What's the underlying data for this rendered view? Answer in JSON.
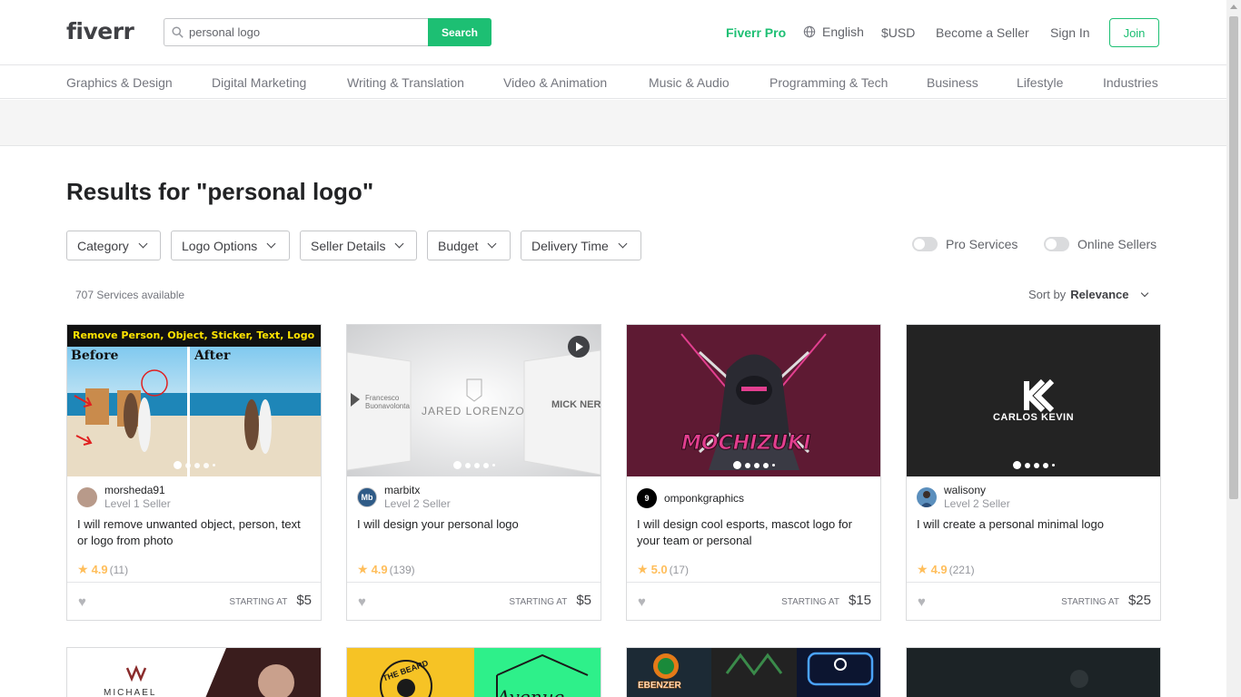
{
  "header": {
    "logo": "fiverr",
    "search_placeholder": "personal logo",
    "search_button": "Search",
    "fiverr_pro": "Fiverr Pro",
    "language": "English",
    "currency": "$USD",
    "become_seller": "Become a Seller",
    "sign_in": "Sign In",
    "join": "Join"
  },
  "categories": [
    "Graphics & Design",
    "Digital Marketing",
    "Writing & Translation",
    "Video & Animation",
    "Music & Audio",
    "Programming & Tech",
    "Business",
    "Lifestyle",
    "Industries"
  ],
  "results_title": "Results for \"personal logo\"",
  "filters": [
    "Category",
    "Logo Options",
    "Seller Details",
    "Budget",
    "Delivery Time"
  ],
  "toggles": [
    "Pro Services",
    "Online Sellers"
  ],
  "services_count": "707 Services available",
  "sort": {
    "label": "Sort by",
    "value": "Relevance"
  },
  "cards": [
    {
      "seller": "morsheda91",
      "level": "Level 1 Seller",
      "title": "I will remove unwanted object, person, text or logo from photo",
      "rating": "4.9",
      "reviews": "(11)",
      "starting_at": "STARTING AT",
      "price": "$5",
      "thumb_banner": "Remove Person, Object, Sticker, Text, Logo",
      "thumb_before": "Before",
      "thumb_after": "After"
    },
    {
      "seller": "marbitx",
      "level": "Level 2 Seller",
      "avatar_text": "Mb",
      "title": "I will design your personal logo",
      "rating": "4.9",
      "reviews": "(139)",
      "starting_at": "STARTING AT",
      "price": "$5",
      "thumb_text_center": "JARED LORENZO",
      "thumb_text_left": "Francesco Buonavolonta",
      "thumb_text_right": "MICK NERTO"
    },
    {
      "seller": "omponkgraphics",
      "level": "",
      "avatar_text": "9",
      "title": "I will design cool esports, mascot logo for your team or personal",
      "rating": "5.0",
      "reviews": "(17)",
      "starting_at": "STARTING AT",
      "price": "$15",
      "thumb_text": "MOCHIZUKI"
    },
    {
      "seller": "walisony",
      "level": "Level 2 Seller",
      "title": "I will create a personal minimal logo",
      "rating": "4.9",
      "reviews": "(221)",
      "starting_at": "STARTING AT",
      "price": "$25",
      "thumb_text": "CARLOS KEVIN"
    }
  ],
  "row2": {
    "card1_text": "MICHAEL",
    "card2_text": "THE BEARD",
    "card2_text_b": "Avenue",
    "card3_text": "EBENZER"
  },
  "colors": {
    "brand_green": "#1dbf73",
    "star_yellow": "#ffbe5b",
    "text_dark": "#404145"
  }
}
